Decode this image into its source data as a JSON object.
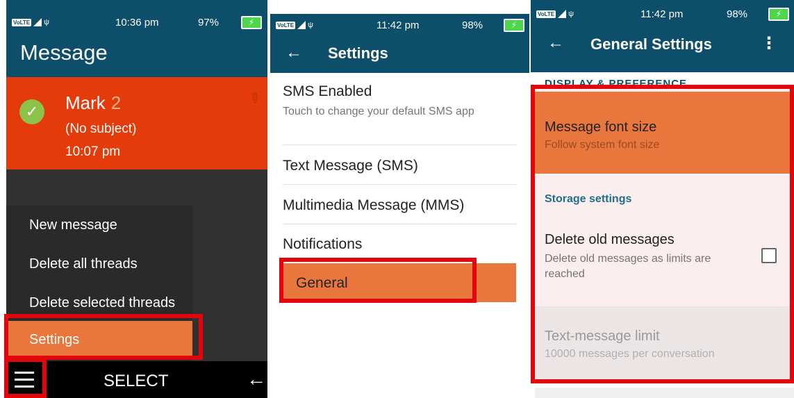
{
  "panel1": {
    "status": {
      "time": "10:36 pm",
      "battery": "97%"
    },
    "title": "Message",
    "thread": {
      "name": "Mark",
      "count": "2",
      "subject": "(No subject)",
      "time": "10:07 pm"
    },
    "menu": [
      "New message",
      "Delete all threads",
      "Delete selected threads",
      "Settings"
    ],
    "bottom": {
      "select_label": "SELECT",
      "back_symbol": "←"
    }
  },
  "panel2": {
    "status": {
      "time": "11:42 pm",
      "battery": "98%"
    },
    "title": "Settings",
    "sms_enabled": {
      "title": "SMS Enabled",
      "subtitle": "Touch to change your default SMS app"
    },
    "items": [
      "Text Message (SMS)",
      "Multimedia Message (MMS)",
      "Notifications",
      "General"
    ]
  },
  "panel3": {
    "status": {
      "time": "11:42 pm",
      "battery": "98%"
    },
    "title": "General Settings",
    "section_display": "DISPLAY & PREFERENCE",
    "font_size": {
      "title": "Message font size",
      "subtitle": "Follow system font size"
    },
    "section_storage": "Storage settings",
    "delete_old": {
      "title": "Delete old messages",
      "subtitle": "Delete old messages as limits are reached",
      "checked": false
    },
    "text_limit": {
      "title": "Text-message limit",
      "subtitle": "10000 messages per conversation"
    }
  },
  "colors": {
    "header": "#0d4e6a",
    "highlight": "#e8763d",
    "thread_red": "#e53b0a",
    "annotation_red": "#e3050b"
  }
}
